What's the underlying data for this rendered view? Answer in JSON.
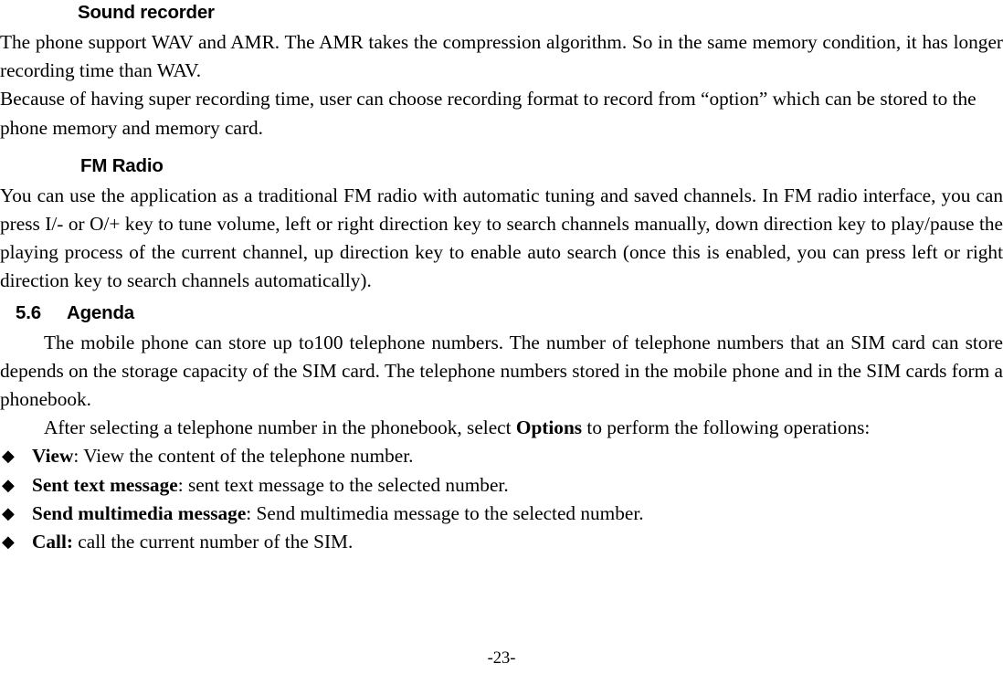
{
  "document": {
    "page_number_label": "-23-"
  },
  "sections": {
    "sound_recorder": {
      "heading": "Sound recorder",
      "paragraph_1": "The phone support WAV and AMR. The AMR takes the compression algorithm. So in the same memory condition, it has longer recording time than WAV.",
      "paragraph_2": "Because of having super recording time, user can choose recording format to record from “option” which can be stored to the phone memory and memory card."
    },
    "fm_radio": {
      "heading": "FM Radio",
      "paragraph_1": "You can use the application as a traditional FM radio with automatic tuning and saved channels. In FM radio interface, you can press I/- or O/+ key to tune volume, left or right direction key to search channels manually, down direction key to play/pause the playing process of the current channel, up direction key to enable auto search (once this is enabled, you can press left or right direction key to search channels automatically)."
    },
    "agenda": {
      "heading_number": "5.6",
      "heading_title": "Agenda",
      "paragraph_1": "The mobile phone can store up to100 telephone numbers. The number of telephone numbers that an SIM card can store depends on the storage capacity of the SIM card. The telephone numbers stored in the mobile phone and in the SIM cards form a phonebook.",
      "paragraph_2_before": "After selecting a telephone number in the phonebook, select ",
      "paragraph_2_bold": "Options",
      "paragraph_2_after": " to perform the following operations:",
      "bullet_marker": "◆",
      "bullets": [
        {
          "label": "View",
          "separator": ": ",
          "text": "View the content of the telephone number."
        },
        {
          "label": "Sent text message",
          "separator": ": ",
          "text": "sent text message to the selected number."
        },
        {
          "label": "Send multimedia message",
          "separator": ": ",
          "text": "Send multimedia message to the selected number."
        },
        {
          "label": "Call:",
          "separator": " ",
          "text": "call the current number of the SIM."
        }
      ]
    }
  }
}
